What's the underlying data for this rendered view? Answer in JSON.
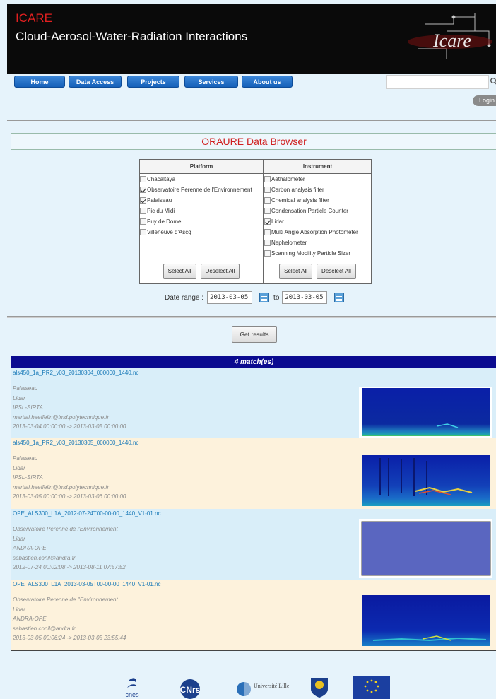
{
  "header": {
    "brand": "ICARE",
    "subtitle": "Cloud-Aerosol-Water-Radiation Interactions",
    "logo_text": "Icare"
  },
  "nav": {
    "items": [
      "Home",
      "Data Access",
      "Projects",
      "Services",
      "About us"
    ],
    "search_placeholder": "",
    "login": "Login"
  },
  "browser": {
    "title": "ORAURE Data Browser",
    "platform": {
      "header": "Platform",
      "options": [
        {
          "label": "Chacaltaya",
          "checked": false
        },
        {
          "label": "Observatoire Perenne de l'Environnement",
          "checked": true
        },
        {
          "label": "Palaiseau",
          "checked": true
        },
        {
          "label": "Pic du Midi",
          "checked": false
        },
        {
          "label": "Puy de Dome",
          "checked": false
        },
        {
          "label": "Villeneuve d'Ascq",
          "checked": false
        }
      ]
    },
    "instrument": {
      "header": "Instrument",
      "options": [
        {
          "label": "Aethalometer",
          "checked": false
        },
        {
          "label": "Carbon analysis filter",
          "checked": false
        },
        {
          "label": "Chemical analysis filter",
          "checked": false
        },
        {
          "label": "Condensation Particle Counter",
          "checked": false
        },
        {
          "label": "Lidar",
          "checked": true
        },
        {
          "label": "Multi Angle Absorption Photometer",
          "checked": false
        },
        {
          "label": "Nephelometer",
          "checked": false
        },
        {
          "label": "Scanning Mobility Particle Sizer",
          "checked": false
        }
      ]
    },
    "select_all": "Select All",
    "deselect_all": "Deselect All",
    "date_label": "Date range :",
    "date_from": "2013-03-05",
    "date_to_label": "to",
    "date_to": "2013-03-05",
    "get_results": "Get results"
  },
  "results": {
    "count_label": "4 match(es)",
    "items": [
      {
        "file": "als450_1a_PR2_v03_20130304_000000_1440.nc",
        "site": "Palaiseau",
        "instrument": "Lidar",
        "provider": "IPSL-SIRTA",
        "contact": "martial.haeffelin@lmd.polytechnique.fr",
        "period": "2013-03-04 00:00:00 -> 2013-03-05 00:00:00"
      },
      {
        "file": "als450_1a_PR2_v03_20130305_000000_1440.nc",
        "site": "Palaiseau",
        "instrument": "Lidar",
        "provider": "IPSL-SIRTA",
        "contact": "martial.haeffelin@lmd.polytechnique.fr",
        "period": "2013-03-05 00:00:00 -> 2013-03-06 00:00:00"
      },
      {
        "file": "OPE_ALS300_L1A_2012-07-24T00-00-00_1440_V1-01.nc",
        "site": "Observatoire Perenne de l'Environnement",
        "instrument": "Lidar",
        "provider": "ANDRA-OPE",
        "contact": "sebastien.conil@andra.fr",
        "period": "2012-07-24 00:02:08 -> 2013-08-11 07:57:52"
      },
      {
        "file": "OPE_ALS300_L1A_2013-03-05T00-00-00_1440_V1-01.nc",
        "site": "Observatoire Perenne de l'Environnement",
        "instrument": "Lidar",
        "provider": "ANDRA-OPE",
        "contact": "sebastien.conil@andra.fr",
        "period": "2013-03-05 00:06:24 -> 2013-03-05 23:55:44"
      }
    ]
  },
  "footer": {
    "logos": [
      "cnes",
      "cnrs",
      "Université Lille1",
      "Observatoire",
      "European Union"
    ],
    "cnes_text": "cnes",
    "cnrs_text": "CNrs",
    "lille_text": "Université Lille1"
  },
  "colors": {
    "nav_button": "#1f6fc8",
    "results_header": "#0b0b90",
    "result_row_a": "#d9eef9",
    "result_row_b": "#fdf2dc",
    "title_red": "#d02020"
  }
}
